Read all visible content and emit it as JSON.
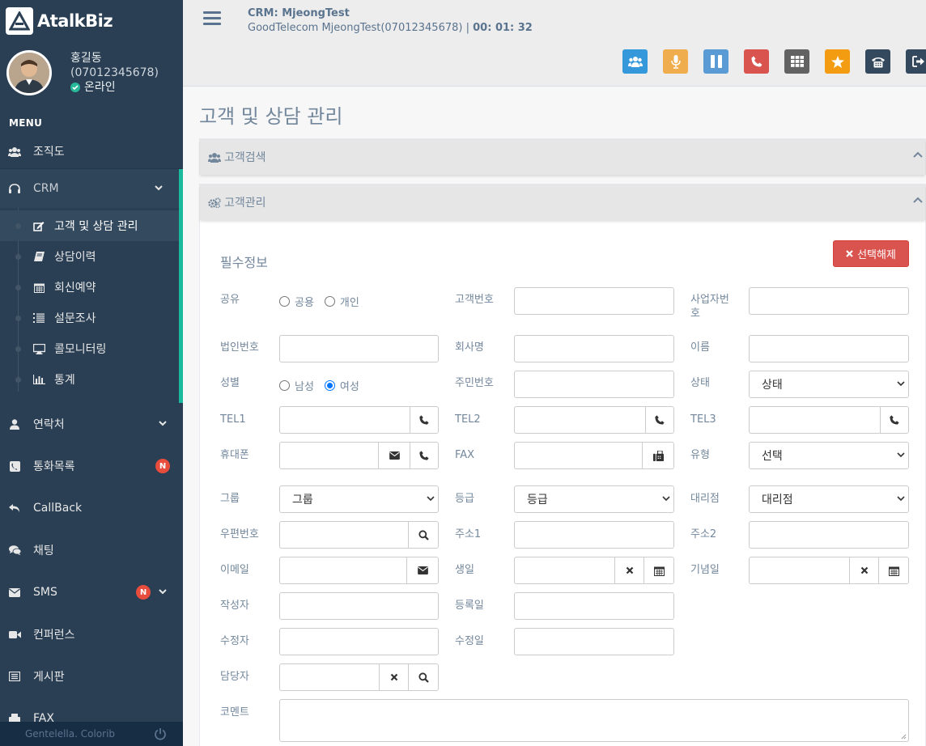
{
  "brand": {
    "name": "AtalkBiz"
  },
  "profile": {
    "name": "홍길동",
    "phone": "(07012345678)",
    "status": "온라인"
  },
  "sidebar": {
    "menu_title": "MENU",
    "org": "조직도",
    "crm": {
      "label": "CRM",
      "items": [
        {
          "label": "고객 및 상담 관리",
          "icon": "edit-icon"
        },
        {
          "label": "상담이력",
          "icon": "book-icon"
        },
        {
          "label": "회신예약",
          "icon": "calendar-icon"
        },
        {
          "label": "설문조사",
          "icon": "list-icon"
        },
        {
          "label": "콜모니터링",
          "icon": "desktop-icon"
        },
        {
          "label": "통계",
          "icon": "bar-chart-icon"
        }
      ]
    },
    "items": [
      {
        "label": "연락처",
        "icon": "user-icon",
        "badge": "",
        "chevron": true
      },
      {
        "label": "통화목록",
        "icon": "phone-square-icon",
        "badge": "N",
        "chevron": false
      },
      {
        "label": "CallBack",
        "icon": "reply-icon",
        "badge": "",
        "chevron": false
      },
      {
        "label": "채팅",
        "icon": "comments-icon",
        "badge": "",
        "chevron": false
      },
      {
        "label": "SMS",
        "icon": "envelope-icon",
        "badge": "N",
        "chevron": true
      },
      {
        "label": "컨퍼런스",
        "icon": "video-icon",
        "badge": "",
        "chevron": false
      },
      {
        "label": "게시판",
        "icon": "list-alt-icon",
        "badge": "",
        "chevron": false
      },
      {
        "label": "FAX",
        "icon": "fax-icon",
        "badge": "",
        "chevron": false
      }
    ],
    "footer": "Gentelella. Colorib"
  },
  "topbar": {
    "call_title": "CRM: MjeongTest",
    "call_detail": "GoodTelecom MjeongTest(07012345678) | ",
    "call_timer": "00: 01: 32"
  },
  "toolbar": [
    {
      "name": "group-call-button",
      "color": "#3498db"
    },
    {
      "name": "mic-button",
      "color": "#f0ad4e"
    },
    {
      "name": "pause-button",
      "color": "#5b9bd5"
    },
    {
      "name": "hangup-button",
      "color": "#d9534f"
    },
    {
      "name": "keypad-button",
      "color": "#626262"
    },
    {
      "name": "favorite-button",
      "color": "#f39c12"
    },
    {
      "name": "transfer-button",
      "color": "#34495e"
    },
    {
      "name": "logout-button",
      "color": "#34495e"
    }
  ],
  "page": {
    "title": "고객 및 상담 관리"
  },
  "panels": {
    "search": "고객검색",
    "manage": "고객관리"
  },
  "form": {
    "section": "필수정보",
    "clear_button": "선택해제",
    "share": {
      "label": "공유",
      "options": [
        "공용",
        "개인"
      ]
    },
    "customer_no": "고객번호",
    "business_no": "사업자번호",
    "corp_no": "법인번호",
    "company": "회사명",
    "name": "이름",
    "gender": {
      "label": "성별",
      "options": [
        "남성",
        "여성"
      ],
      "selected": "여성"
    },
    "resident_no": "주민번호",
    "status": {
      "label": "상태",
      "value": "상태"
    },
    "tel1": "TEL1",
    "tel2": "TEL2",
    "tel3": "TEL3",
    "mobile": "휴대폰",
    "fax": "FAX",
    "type": {
      "label": "유형",
      "value": "선택"
    },
    "group": {
      "label": "그룹",
      "value": "그룹"
    },
    "grade": {
      "label": "등급",
      "value": "등급"
    },
    "agency": {
      "label": "대리점",
      "value": "대리점"
    },
    "zipcode": "우편번호",
    "addr1": "주소1",
    "addr2": "주소2",
    "email": "이메일",
    "birthday": "생일",
    "anniversary": "기념일",
    "author": "작성자",
    "reg_date": "등록일",
    "editor": "수정자",
    "mod_date": "수정일",
    "manager": "담당자",
    "comment": "코멘트"
  }
}
